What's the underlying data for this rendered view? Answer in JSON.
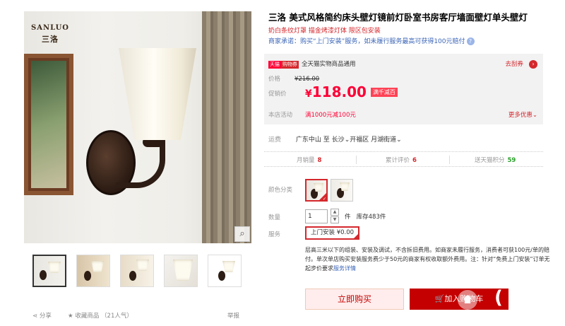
{
  "gallery": {
    "logo_text": "SANLUO",
    "logo_cn": "三洛",
    "zoom_icon": "magnifier-icon"
  },
  "share": {
    "share_label": "分享",
    "favorite_label": "收藏商品",
    "favorite_count": "（21人气）",
    "report_label": "举报"
  },
  "product": {
    "title": "三洛 美式风格简约床头壁灯镜前灯卧室书房客厅墙面壁灯单头壁灯",
    "subtitle": "奶白条纹灯罩 描金烤漆灯体 限区包安装",
    "promise": "商家承诺：购买“上门安装”服务，如未履行服务最高可获得100元赔付",
    "promise_help": "?"
  },
  "price_box": {
    "tmall_badge": "天猫",
    "coupon_badge": "购物券",
    "coupon_desc": "全天猫实物商品通用",
    "get_coupon": "去刮券",
    "price_label": "价格",
    "original_price": "¥216.00",
    "promo_label": "促销价",
    "currency": "¥",
    "promo_price": "118.00",
    "promo_tag": "满千减百",
    "activity_label": "本店活动",
    "activity_value": "满1000元减100元",
    "more_offers": "更多优惠"
  },
  "shipping": {
    "label": "运费",
    "from": "广东中山",
    "to_label": "至",
    "dest_city": "长沙",
    "dest_district": "开福区",
    "dest_street": "月湖街道"
  },
  "stats": {
    "monthly_sales_label": "月销量",
    "monthly_sales": "8",
    "reviews_label": "累计评价",
    "reviews": "6",
    "points_label": "送天猫积分",
    "points": "59"
  },
  "options": {
    "color_label": "颜色分类",
    "qty_label": "数量",
    "qty_value": "1",
    "qty_unit": "件",
    "stock": "库存483件",
    "service_label": "服务",
    "service_option": "上门安装 ¥0.00",
    "service_desc": "层高三米以下的组装、安装及调试，不含拆旧费用。如商家未履行服务，消费者可获100元/单的赔付。单次单店购买安装服务费少于50元的商家有权收取额外费用。注：针对“免费上门安装”订单无起步价要求",
    "service_link": "服务详情"
  },
  "actions": {
    "buy_now": "立即购买",
    "add_to_cart": "加入购物车"
  },
  "colors": {
    "brand_red": "#c40000",
    "price_red": "#ff0036",
    "link_blue": "#3c66b7",
    "points_green": "#2aa02a"
  }
}
